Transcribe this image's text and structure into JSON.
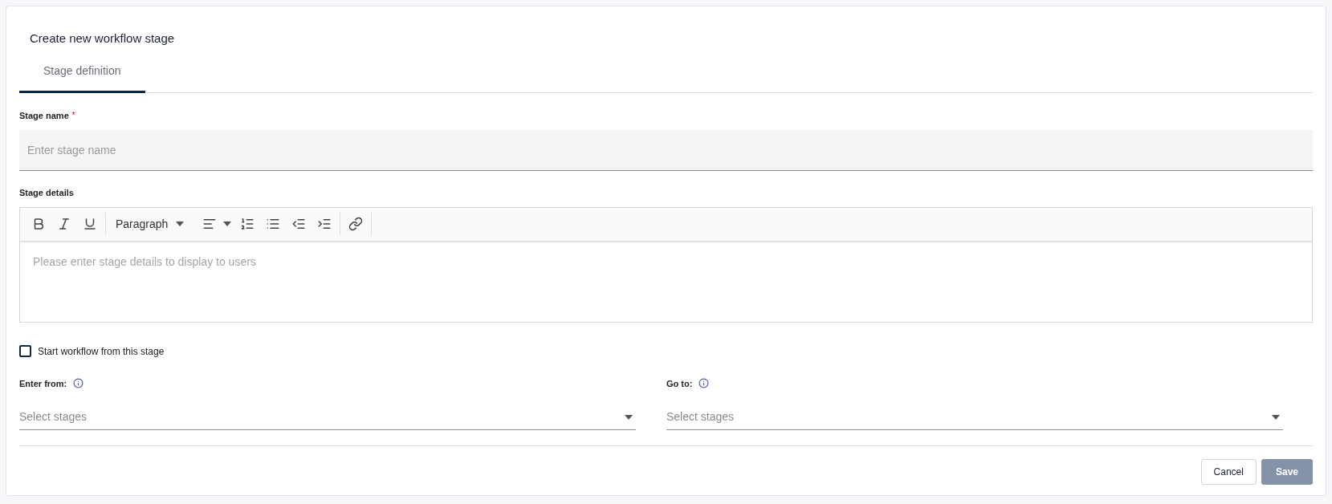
{
  "dialog": {
    "title": "Create new workflow stage"
  },
  "tabs": [
    {
      "label": "Stage definition",
      "selected": true
    }
  ],
  "stage_name": {
    "label": "Stage name",
    "required_mark": "*",
    "placeholder": "Enter stage name"
  },
  "stage_details": {
    "label": "Stage details",
    "block_format": "Paragraph",
    "placeholder": "Please enter stage details to display to users"
  },
  "start_checkbox": {
    "label": "Start workflow from this stage",
    "checked": false
  },
  "selects": [
    {
      "label": "Enter from:",
      "placeholder": "Select stages"
    },
    {
      "label": "Go to:",
      "placeholder": "Select stages"
    }
  ],
  "buttons": [
    {
      "label": "Cancel",
      "kind": "secondary",
      "disabled": false
    },
    {
      "label": "Save",
      "kind": "primary",
      "disabled": true
    }
  ]
}
